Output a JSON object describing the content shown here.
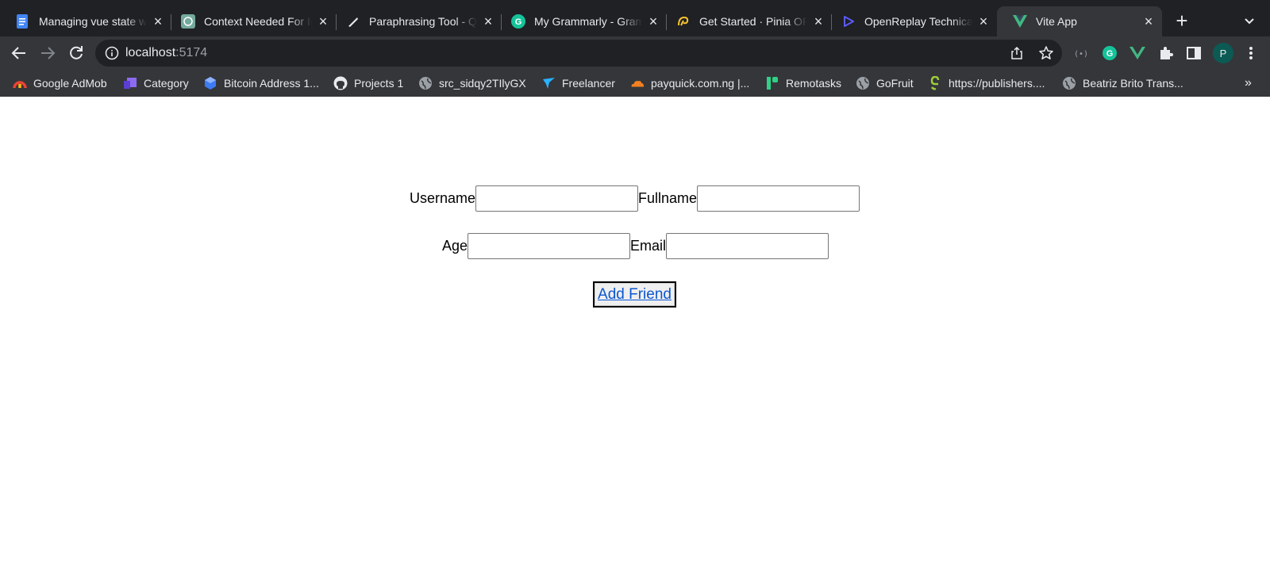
{
  "browser": {
    "tabs": [
      {
        "title": "Managing vue state w",
        "icon": "google-docs-icon",
        "active": false
      },
      {
        "title": "Context Needed For In",
        "icon": "chatgpt-icon",
        "active": false
      },
      {
        "title": "Paraphrasing Tool - Q",
        "icon": "quillbot-icon",
        "active": false
      },
      {
        "title": "My Grammarly - Gram",
        "icon": "grammarly-icon",
        "active": false
      },
      {
        "title": "Get Started · Pinia OR",
        "icon": "pinia-icon",
        "active": false
      },
      {
        "title": "OpenReplay Technica",
        "icon": "openreplay-icon",
        "active": false
      },
      {
        "title": "Vite App",
        "icon": "vue-icon",
        "active": true
      }
    ],
    "new_tab": "+",
    "address": {
      "host": "localhost",
      "port": ":5174"
    },
    "profile_initial": "P",
    "bookmarks": [
      {
        "label": "Google AdMob",
        "icon": "admob-icon"
      },
      {
        "label": "Category",
        "icon": "category-icon"
      },
      {
        "label": "Bitcoin Address 1...",
        "icon": "bitcoin-icon"
      },
      {
        "label": "Projects 1",
        "icon": "github-icon"
      },
      {
        "label": "src_sidqy2TIlyGX",
        "icon": "globe-icon"
      },
      {
        "label": "Freelancer",
        "icon": "freelancer-icon"
      },
      {
        "label": "payquick.com.ng |...",
        "icon": "cloudflare-icon"
      },
      {
        "label": "Remotasks",
        "icon": "remotasks-icon"
      },
      {
        "label": "GoFruit",
        "icon": "globe-icon"
      },
      {
        "label": "https://publishers....",
        "icon": "publishers-icon"
      },
      {
        "label": "Beatriz Brito Trans...",
        "icon": "globe-icon"
      }
    ],
    "bookmarks_more": "»"
  },
  "form": {
    "username_label": "Username",
    "username_value": "",
    "fullname_label": "Fullname",
    "fullname_value": "",
    "age_label": "Age",
    "age_value": "",
    "email_label": "Email",
    "email_value": "",
    "submit_label": "Add Friend"
  },
  "colors": {
    "tabstrip_bg": "#202124",
    "toolbar_bg": "#35363a",
    "link_blue": "#0b57d0"
  }
}
